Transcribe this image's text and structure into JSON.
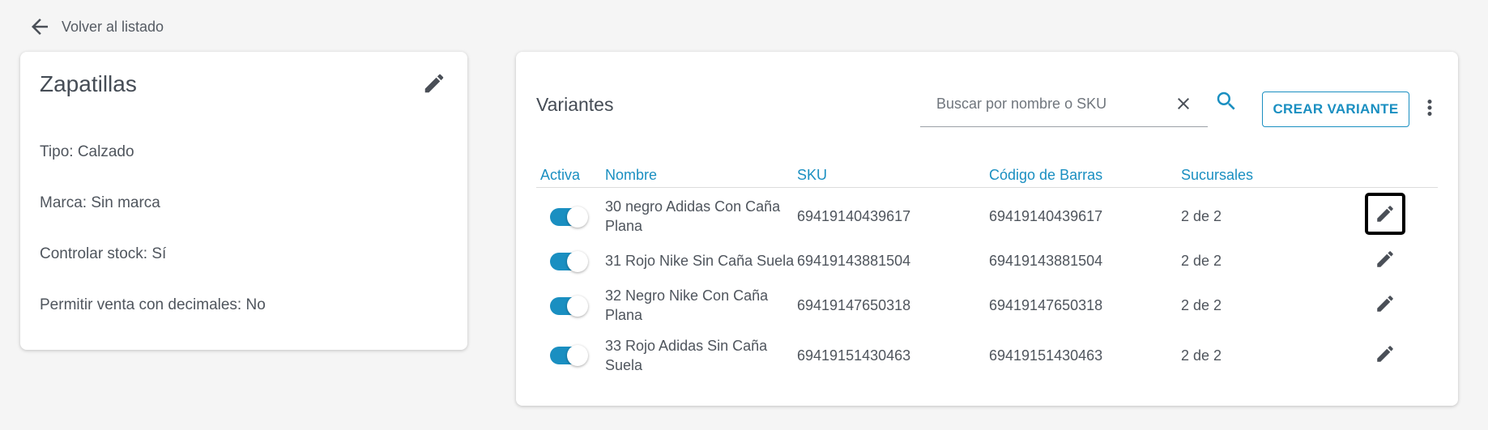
{
  "nav": {
    "back_label": "Volver al listado",
    "back_icon": "arrow-left-icon"
  },
  "product": {
    "title": "Zapatillas",
    "edit_icon": "pencil-icon",
    "properties": [
      "Tipo: Calzado",
      "Marca: Sin marca",
      "Controlar stock: Sí",
      "Permitir venta con decimales: No"
    ]
  },
  "variants": {
    "title": "Variantes",
    "search": {
      "placeholder": "Buscar por nombre o SKU",
      "value": ""
    },
    "clear_icon": "close-icon",
    "search_icon": "search-icon",
    "create_label": "CREAR VARIANTE",
    "more_icon": "more-vertical-icon",
    "columns": [
      "Activa",
      "Nombre",
      "SKU",
      "Código de Barras",
      "Sucursales"
    ],
    "rows": [
      {
        "active": true,
        "name_line1": "30 negro Adidas Con Caña",
        "name_line2": "Plana",
        "sku": "69419140439617",
        "barcode": "69419140439617",
        "branches": "2 de 2"
      },
      {
        "active": true,
        "name_line1": "31 Rojo Nike Sin Caña Suela",
        "name_line2": "",
        "sku": "69419143881504",
        "barcode": "69419143881504",
        "branches": "2 de 2"
      },
      {
        "active": true,
        "name_line1": "32 Negro Nike Con Caña",
        "name_line2": "Plana",
        "sku": "69419147650318",
        "barcode": "69419147650318",
        "branches": "2 de 2"
      },
      {
        "active": true,
        "name_line1": "33 Rojo Adidas Sin Caña",
        "name_line2": "Suela",
        "sku": "69419151430463",
        "barcode": "69419151430463",
        "branches": "2 de 2"
      }
    ]
  },
  "colors": {
    "accent": "#1a8fc1",
    "background": "#f5f5f5",
    "card": "#ffffff",
    "text": "#4a4f57"
  }
}
